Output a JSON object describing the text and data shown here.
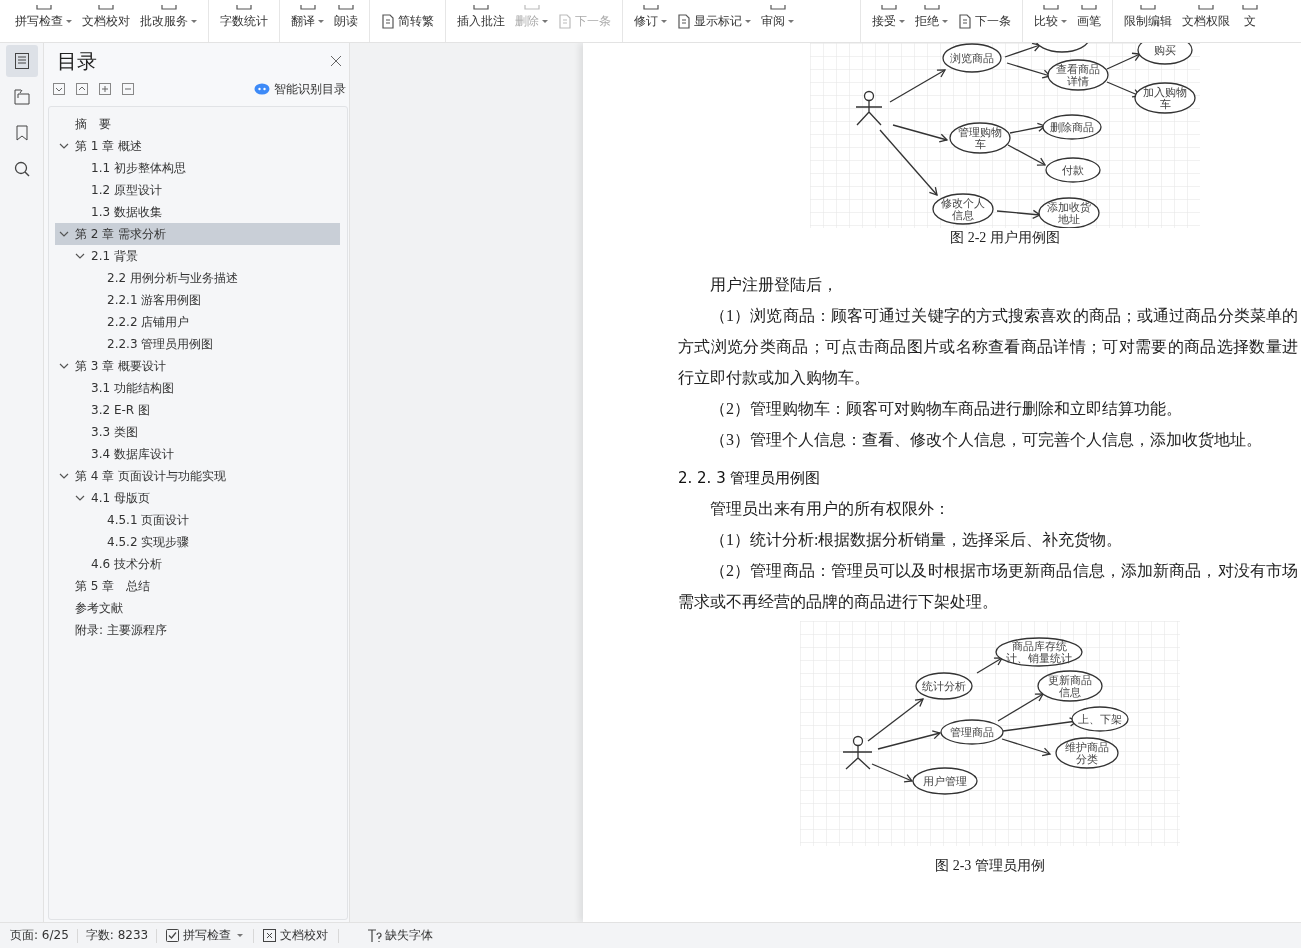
{
  "toolbar": {
    "groups": [
      [
        {
          "label": "拼写检查",
          "kind": "stacked",
          "dropdown": true,
          "disabled": false
        },
        {
          "label": "文档校对",
          "kind": "stacked",
          "dropdown": false,
          "disabled": false
        },
        {
          "label": "批改服务",
          "kind": "stacked",
          "dropdown": true,
          "disabled": false
        }
      ],
      [
        {
          "label": "字数统计",
          "kind": "stacked",
          "dropdown": false,
          "disabled": false
        }
      ],
      [
        {
          "label": "翻译",
          "kind": "stacked",
          "dropdown": true,
          "disabled": false
        },
        {
          "label": "朗读",
          "kind": "stacked",
          "dropdown": false,
          "disabled": false
        }
      ],
      [
        {
          "label": "简转繁",
          "kind": "inline",
          "dropdown": false,
          "disabled": false
        }
      ],
      [
        {
          "label": "插入批注",
          "kind": "stacked",
          "dropdown": false,
          "disabled": false
        },
        {
          "label": "删除",
          "kind": "stacked",
          "dropdown": true,
          "disabled": true
        },
        {
          "label": "下一条",
          "kind": "inline",
          "dropdown": false,
          "disabled": true
        }
      ],
      [
        {
          "label": "修订",
          "kind": "stacked",
          "dropdown": true,
          "disabled": false
        },
        {
          "label": "显示标记",
          "kind": "inline",
          "dropdown": true,
          "disabled": false
        },
        {
          "label": "审阅",
          "kind": "stacked",
          "dropdown": true,
          "disabled": false
        }
      ],
      [
        {
          "label": "接受",
          "kind": "stacked",
          "dropdown": true,
          "disabled": false
        },
        {
          "label": "拒绝",
          "kind": "stacked",
          "dropdown": true,
          "disabled": false
        },
        {
          "label": "下一条",
          "kind": "inline",
          "dropdown": false,
          "disabled": false
        }
      ],
      [
        {
          "label": "比较",
          "kind": "stacked",
          "dropdown": true,
          "disabled": false
        },
        {
          "label": "画笔",
          "kind": "stacked",
          "dropdown": false,
          "disabled": false
        }
      ],
      [
        {
          "label": "限制编辑",
          "kind": "stacked",
          "dropdown": false,
          "disabled": false
        },
        {
          "label": "文档权限",
          "kind": "stacked",
          "dropdown": false,
          "disabled": false
        },
        {
          "label": "文",
          "kind": "stacked",
          "dropdown": false,
          "disabled": false
        }
      ]
    ]
  },
  "rail": [
    {
      "selected": true
    },
    {
      "selected": false
    },
    {
      "selected": false
    },
    {
      "selected": false
    }
  ],
  "toc": {
    "title": "目录",
    "smart_button": "智能识别目录",
    "items": [
      {
        "label": "摘　要",
        "selected": false
      },
      {
        "label": "第 1 章 概述",
        "selected": false,
        "expanded": true,
        "children": [
          {
            "label": "1.1 初步整体构思",
            "selected": false
          },
          {
            "label": "1.2 原型设计",
            "selected": false
          },
          {
            "label": "1.3 数据收集",
            "selected": false
          }
        ]
      },
      {
        "label": "第 2 章 需求分析",
        "selected": true,
        "expanded": true,
        "children": [
          {
            "label": "2.1 背景",
            "selected": false,
            "expanded": true,
            "children": [
              {
                "label": "2.2 用例分析与业务描述",
                "selected": false
              },
              {
                "label": "2.2.1 游客用例图",
                "selected": false
              },
              {
                "label": "2.2.2  店铺用户",
                "selected": false
              },
              {
                "label": "2.2.3 管理员用例图",
                "selected": false
              }
            ]
          }
        ]
      },
      {
        "label": "第 3 章 概要设计",
        "selected": false,
        "expanded": true,
        "children": [
          {
            "label": "3.1 功能结构图",
            "selected": false
          },
          {
            "label": "3.2 E-R 图",
            "selected": false
          },
          {
            "label": "3.3  类图",
            "selected": false
          },
          {
            "label": "3.4 数据库设计",
            "selected": false
          }
        ]
      },
      {
        "label": "第 4 章 页面设计与功能实现",
        "selected": false,
        "expanded": true,
        "children": [
          {
            "label": "4.1 母版页",
            "selected": false,
            "expanded": true,
            "children": [
              {
                "label": "4.5.1 页面设计",
                "selected": false
              },
              {
                "label": "4.5.2 实现步骤",
                "selected": false
              }
            ]
          },
          {
            "label": "4.6 技术分析",
            "selected": false
          }
        ]
      },
      {
        "label": "第 5 章　总结",
        "selected": false
      },
      {
        "label": "参考文献",
        "selected": false
      },
      {
        "label": "附录: 主要源程序",
        "selected": false
      }
    ]
  },
  "document": [
    {
      "kind": "figure",
      "nodes": [
        "浏览商品",
        "查看商品详情",
        "购买",
        "加入购物车",
        "管理购物车",
        "删除商品",
        "付款",
        "修改个人信息",
        "添加收货地址"
      ],
      "caption": "图 2-2 用户用例图"
    },
    {
      "kind": "paragraph",
      "text": "用户注册登陆后，"
    },
    {
      "kind": "paragraph",
      "text": "（1）浏览商品：顾客可通过关键字的方式搜索喜欢的商品；或通过商品分类菜单的方式浏览分类商品；可点击商品图片或名称查看商品详情；可对需要的商品选择数量进行立即付款或加入购物车。"
    },
    {
      "kind": "paragraph",
      "text": "（2）管理购物车：顾客可对购物车商品进行删除和立即结算功能。"
    },
    {
      "kind": "paragraph",
      "text": "（3）管理个人信息：查看、修改个人信息，可完善个人信息，添加收货地址。"
    },
    {
      "kind": "heading",
      "text": "2. 2. 3 管理员用例图"
    },
    {
      "kind": "paragraph",
      "text": "管理员出来有用户的所有权限外："
    },
    {
      "kind": "paragraph",
      "text": "（1）统计分析:根据数据分析销量，选择采后、补充货物。"
    },
    {
      "kind": "paragraph",
      "text": "（2）管理商品：管理员可以及时根据市场更新商品信息，添加新商品，对没有市场需求或不再经营的品牌的商品进行下架处理。"
    },
    {
      "kind": "figure",
      "nodes": [
        "商品库存统计、销量统计",
        "统计分析",
        "更新商品信息",
        "管理商品",
        "上、下架",
        "维护商品分类",
        "用户管理"
      ],
      "caption": "图 2-3 管理员用例"
    }
  ],
  "status_bar": [
    {
      "label": "页面: 6/25",
      "kind": "text"
    },
    {
      "label": "字数: 8233",
      "kind": "text"
    },
    {
      "label": "拼写检查",
      "kind": "spellcheck"
    },
    {
      "label": "文档校对",
      "kind": "proofread"
    },
    {
      "label": "缺失字体",
      "kind": "fonts"
    }
  ]
}
